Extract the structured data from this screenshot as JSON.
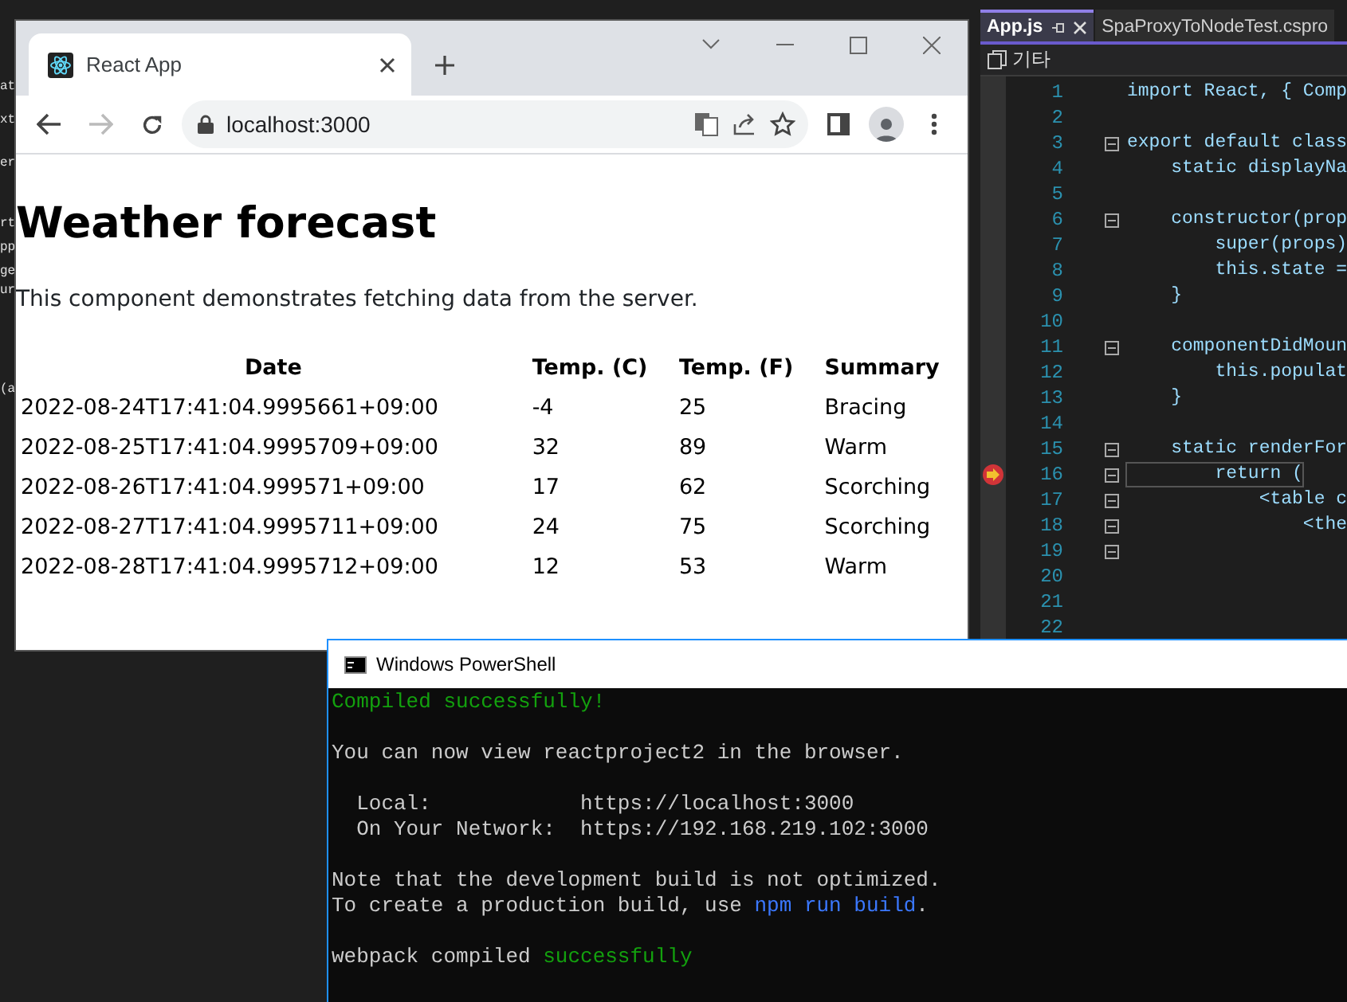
{
  "left_panel_fragments": [
    "at",
    "xt",
    "er",
    "rt",
    "pp",
    "ge",
    "ur",
    "(a"
  ],
  "editor": {
    "tabs": [
      {
        "label": "App.js",
        "selected": true
      },
      {
        "label": "SpaProxyToNodeTest.cspro",
        "selected": false
      }
    ],
    "toolbar_label": "기타",
    "lines": [
      {
        "number": "1",
        "code": "import React, { Comp",
        "fold": false,
        "current": false
      },
      {
        "number": "2",
        "fold": false,
        "current": false
      },
      {
        "number": "3",
        "code": "export default class",
        "fold": true,
        "current": false
      },
      {
        "number": "4",
        "code": "    static displayNa",
        "fold": false,
        "current": false
      },
      {
        "number": "5",
        "fold": false,
        "current": false
      },
      {
        "number": "6",
        "code": "    constructor(prop",
        "fold": true,
        "current": false
      },
      {
        "number": "7",
        "code": "        super(props)",
        "fold": false,
        "current": false
      },
      {
        "number": "8",
        "code": "        this.state =",
        "fold": false,
        "current": false
      },
      {
        "number": "9",
        "code": "    }",
        "fold": false,
        "current": false
      },
      {
        "number": "10",
        "fold": false,
        "current": false
      },
      {
        "number": "11",
        "code": "    componentDidMoun",
        "fold": true,
        "current": false
      },
      {
        "number": "12",
        "code": "        this.populat",
        "fold": false,
        "current": false
      },
      {
        "number": "13",
        "code": "    }",
        "fold": false,
        "current": false
      },
      {
        "number": "14",
        "fold": false,
        "current": false
      },
      {
        "number": "15",
        "code": "    static renderFor",
        "fold": true,
        "current": false
      },
      {
        "number": "16",
        "code": "        return (",
        "fold": true,
        "current": true
      },
      {
        "number": "17",
        "code": "            <table c",
        "fold": true,
        "current": false
      },
      {
        "number": "18",
        "code": "                <the",
        "fold": true,
        "current": false
      },
      {
        "number": "19",
        "fold": true,
        "current": false
      },
      {
        "number": "20",
        "fold": false,
        "current": false
      },
      {
        "number": "21",
        "fold": false,
        "current": false
      },
      {
        "number": "22",
        "fold": false,
        "current": false
      }
    ]
  },
  "browser": {
    "tab_title": "React App",
    "url": "localhost:3000",
    "heading": "Weather forecast",
    "intro": "This component demonstrates fetching data from the server.",
    "table": {
      "columns": [
        "Date",
        "Temp. (C)",
        "Temp. (F)",
        "Summary"
      ],
      "rows": [
        [
          "2022-08-24T17:41:04.9995661+09:00",
          "-4",
          "25",
          "Bracing"
        ],
        [
          "2022-08-25T17:41:04.9995709+09:00",
          "32",
          "89",
          "Warm"
        ],
        [
          "2022-08-26T17:41:04.999571+09:00",
          "17",
          "62",
          "Scorching"
        ],
        [
          "2022-08-27T17:41:04.9995711+09:00",
          "24",
          "75",
          "Scorching"
        ],
        [
          "2022-08-28T17:41:04.9995712+09:00",
          "12",
          "53",
          "Warm"
        ]
      ]
    }
  },
  "terminal": {
    "title": "Windows PowerShell",
    "paragraphs": [
      [
        [
          {
            "text": "Compiled successfully!",
            "kind": "success"
          }
        ]
      ],
      [
        [
          {
            "text": "You can now view reactproject2 in the browser.",
            "kind": "normal"
          }
        ]
      ],
      [
        [
          {
            "text": "  Local:            https://localhost:3000",
            "kind": "normal"
          }
        ],
        [
          {
            "text": "  On Your Network:  https://192.168.219.102:3000",
            "kind": "normal"
          }
        ]
      ],
      [
        [
          {
            "text": "Note that the development build is not optimized.",
            "kind": "normal"
          }
        ],
        [
          {
            "text": "To create a production build, use ",
            "kind": "normal"
          },
          {
            "text": "npm run build",
            "kind": "command"
          },
          {
            "text": ".",
            "kind": "normal"
          }
        ]
      ],
      [
        [
          {
            "text": "webpack compiled ",
            "kind": "normal"
          },
          {
            "text": "successfully",
            "kind": "success"
          }
        ]
      ]
    ]
  }
}
